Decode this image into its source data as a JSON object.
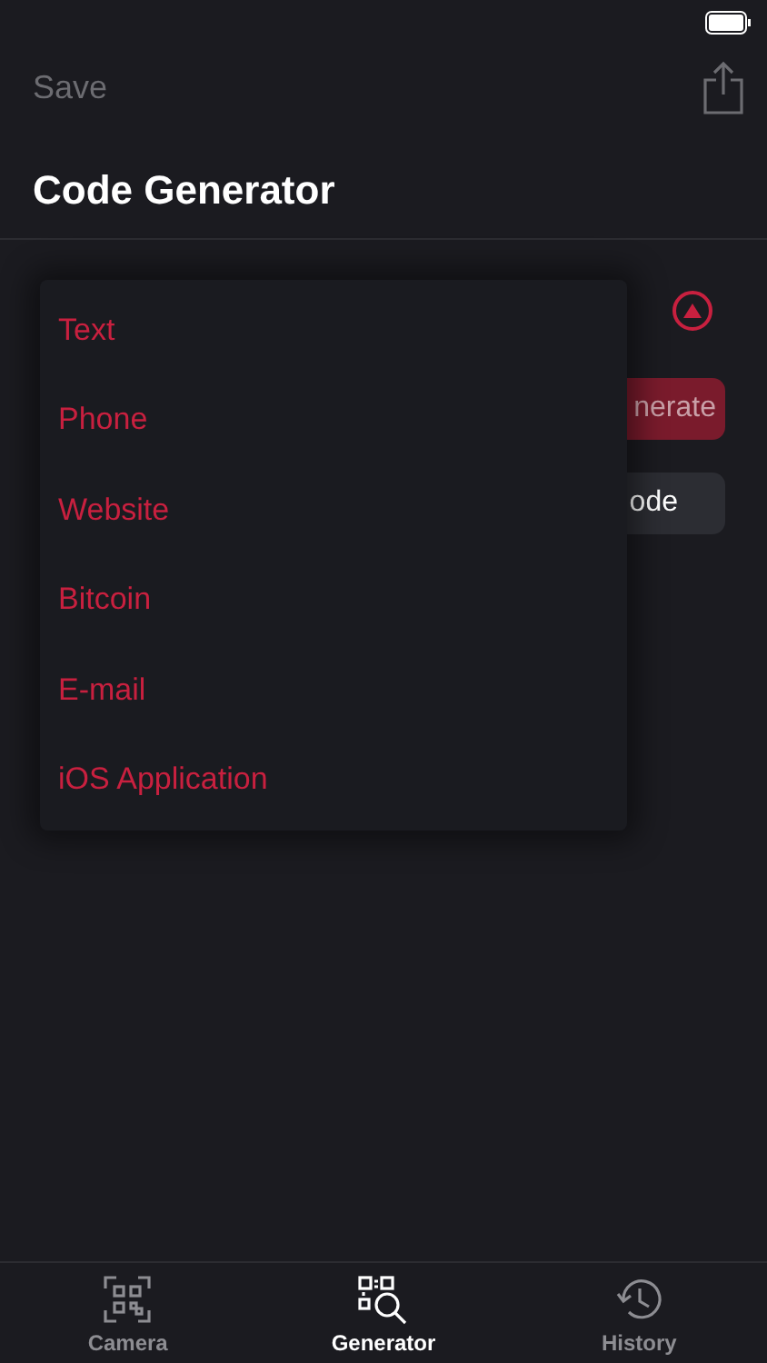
{
  "nav": {
    "left_button": "Save",
    "title": "Code Generator"
  },
  "background_buttons": [
    {
      "label": "nerate",
      "kind": "primary"
    },
    {
      "label": "ode",
      "kind": "secondary"
    }
  ],
  "dropdown": {
    "expanded": true,
    "options": [
      {
        "label": "Text"
      },
      {
        "label": "Phone"
      },
      {
        "label": "Website"
      },
      {
        "label": "Bitcoin"
      },
      {
        "label": "E-mail"
      },
      {
        "label": "iOS Application"
      }
    ]
  },
  "tab_bar": [
    {
      "label": "Camera",
      "kind": "camera",
      "selected": false
    },
    {
      "label": "Generator",
      "kind": "generator",
      "selected": true
    },
    {
      "label": "History",
      "kind": "history",
      "selected": false
    }
  ]
}
